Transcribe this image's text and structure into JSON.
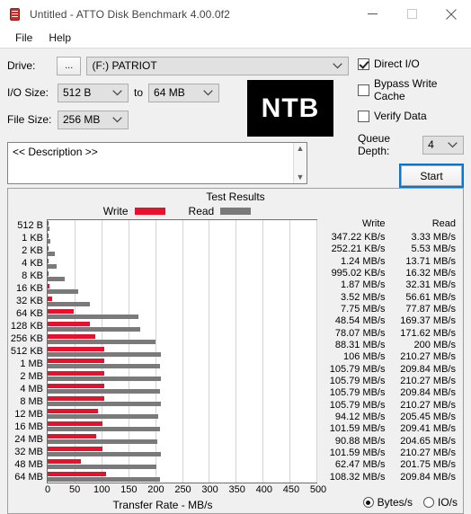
{
  "window": {
    "title": "Untitled - ATTO Disk Benchmark 4.00.0f2",
    "app_icon": "disk-drum-icon",
    "minimize_label": "Minimize",
    "maximize_label": "Maximize",
    "close_label": "Close"
  },
  "menu": {
    "items": [
      {
        "label": "File"
      },
      {
        "label": "Help"
      }
    ]
  },
  "settings": {
    "drive_label": "Drive:",
    "browse_label": "...",
    "drive_value": "(F:) PATRIOT",
    "io_size_label": "I/O Size:",
    "io_size_from": "512 B",
    "io_size_to_label": "to",
    "io_size_to": "64 MB",
    "file_size_label": "File Size:",
    "file_size_value": "256 MB",
    "logo_text": "NTB"
  },
  "options": {
    "direct_io_label": "Direct I/O",
    "direct_io_checked": true,
    "bypass_write_cache_label": "Bypass Write Cache",
    "bypass_write_cache_checked": false,
    "verify_data_label": "Verify Data",
    "verify_data_checked": false,
    "queue_depth_label": "Queue Depth:",
    "queue_depth_value": "4",
    "start_label": "Start"
  },
  "description": {
    "value": "<< Description >>",
    "scroll_up": "▲",
    "scroll_down": "▼"
  },
  "results": {
    "title": "Test Results",
    "legend": [
      {
        "label": "Write",
        "color": "#e8112d"
      },
      {
        "label": "Read",
        "color": "#7a7a7a"
      }
    ],
    "write_header": "Write",
    "read_header": "Read",
    "units": {
      "bytes_label": "Bytes/s",
      "bytes_selected": true,
      "io_label": "IO/s",
      "io_selected": false
    }
  },
  "chart_data": {
    "type": "bar",
    "title": "Test Results",
    "xlabel": "Transfer Rate - MB/s",
    "ylabel": "",
    "orientation": "horizontal",
    "xlim": [
      0,
      500
    ],
    "xticks": [
      0,
      50,
      100,
      150,
      200,
      250,
      300,
      350,
      400,
      450,
      500
    ],
    "grid": true,
    "legend_position": "top",
    "categories": [
      "512 B",
      "1 KB",
      "2 KB",
      "4 KB",
      "8 KB",
      "16 KB",
      "32 KB",
      "64 KB",
      "128 KB",
      "256 KB",
      "512 KB",
      "1 MB",
      "2 MB",
      "4 MB",
      "8 MB",
      "12 MB",
      "16 MB",
      "24 MB",
      "32 MB",
      "48 MB",
      "64 MB"
    ],
    "series": [
      {
        "name": "Write",
        "color": "#e8112d",
        "values_mbps": [
          0.339,
          0.246,
          1.24,
          0.972,
          1.87,
          3.52,
          7.75,
          48.54,
          78.07,
          88.31,
          106,
          105.79,
          105.79,
          105.79,
          105.79,
          94.12,
          101.59,
          90.88,
          101.59,
          62.47,
          108.32
        ],
        "labels": [
          "347.22 KB/s",
          "252.21 KB/s",
          "1.24 MB/s",
          "995.02 KB/s",
          "1.87 MB/s",
          "3.52 MB/s",
          "7.75 MB/s",
          "48.54 MB/s",
          "78.07 MB/s",
          "88.31 MB/s",
          "106 MB/s",
          "105.79 MB/s",
          "105.79 MB/s",
          "105.79 MB/s",
          "105.79 MB/s",
          "94.12 MB/s",
          "101.59 MB/s",
          "90.88 MB/s",
          "101.59 MB/s",
          "62.47 MB/s",
          "108.32 MB/s"
        ]
      },
      {
        "name": "Read",
        "color": "#7a7a7a",
        "values_mbps": [
          3.33,
          5.53,
          13.71,
          16.32,
          32.31,
          56.61,
          77.87,
          169.37,
          171.62,
          200,
          210.27,
          209.84,
          210.27,
          209.84,
          210.27,
          205.45,
          209.41,
          204.65,
          210.27,
          201.75,
          209.84
        ],
        "labels": [
          "3.33 MB/s",
          "5.53 MB/s",
          "13.71 MB/s",
          "16.32 MB/s",
          "32.31 MB/s",
          "56.61 MB/s",
          "77.87 MB/s",
          "169.37 MB/s",
          "171.62 MB/s",
          "200 MB/s",
          "210.27 MB/s",
          "209.84 MB/s",
          "210.27 MB/s",
          "209.84 MB/s",
          "210.27 MB/s",
          "205.45 MB/s",
          "209.41 MB/s",
          "204.65 MB/s",
          "210.27 MB/s",
          "201.75 MB/s",
          "209.84 MB/s"
        ]
      }
    ]
  }
}
